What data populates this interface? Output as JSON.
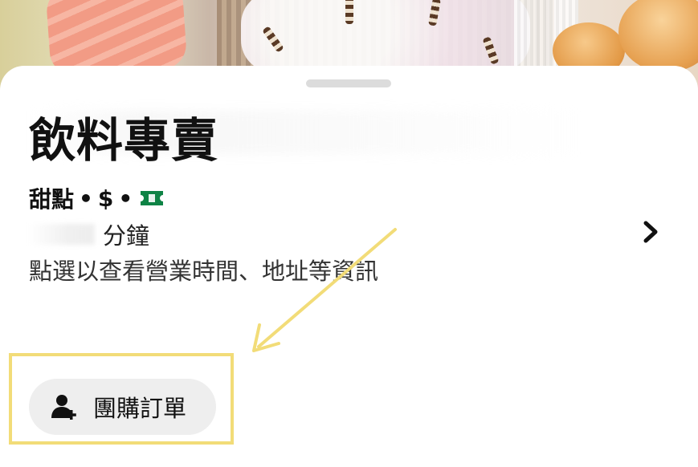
{
  "store": {
    "title": "飲料專賣",
    "category": "甜點",
    "separator": "•",
    "price_level": "$",
    "ticket_icon": "ticket-icon",
    "ticket_color": "#0e8345"
  },
  "delivery": {
    "time_unit": "分鐘"
  },
  "info": {
    "hint": "點選以查看營業時間、地址等資訊"
  },
  "actions": {
    "group_order_label": "團購訂單",
    "group_order_icon": "add-person-icon"
  },
  "colors": {
    "highlight": "#f2dc78",
    "button_bg": "#eeeeee",
    "text": "#111111"
  }
}
